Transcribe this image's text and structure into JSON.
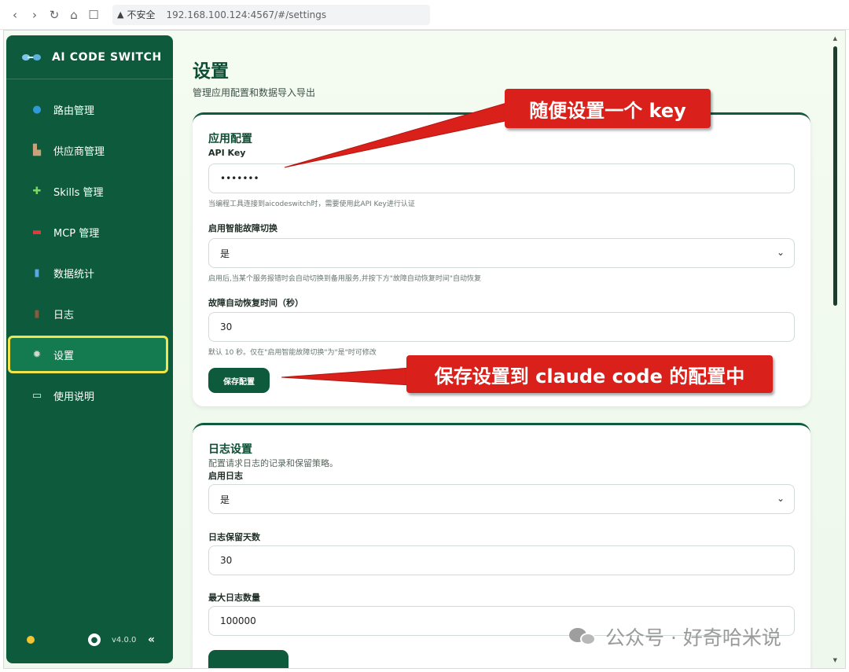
{
  "browser": {
    "back": "‹",
    "forward": "›",
    "reload": "↻",
    "home": "⌂",
    "bookmark": "☐",
    "warn_icon": "▲",
    "insecure_label": "不安全",
    "url": "192.168.100.124:4567/#/settings"
  },
  "sidebar": {
    "brand": "AI CODE SWITCH",
    "items": [
      {
        "label": "路由管理",
        "icon": "globe-icon",
        "glyph": "●",
        "color": "#2f9ad8"
      },
      {
        "label": "供应商管理",
        "icon": "factory-icon",
        "glyph": "▙",
        "color": "#c9a27a"
      },
      {
        "label": "Skills 管理",
        "icon": "puzzle-icon",
        "glyph": "✚",
        "color": "#7ed957"
      },
      {
        "label": "MCP 管理",
        "icon": "robot-icon",
        "glyph": "▬",
        "color": "#e0393e"
      },
      {
        "label": "数据统计",
        "icon": "chart-icon",
        "glyph": "▮",
        "color": "#5aa7e6"
      },
      {
        "label": "日志",
        "icon": "log-icon",
        "glyph": "▮",
        "color": "#8b5a3c"
      },
      {
        "label": "设置",
        "icon": "gear-icon",
        "glyph": "✹",
        "color": "#cfd8d3"
      },
      {
        "label": "使用说明",
        "icon": "book-icon",
        "glyph": "▭",
        "color": "#dfe9f5"
      }
    ],
    "active_index": 6,
    "github_glyph": "●",
    "version": "v4.0.0",
    "collapse": "«"
  },
  "page": {
    "title": "设置",
    "subtitle": "管理应用配置和数据导入导出"
  },
  "app_config": {
    "title": "应用配置",
    "api_key_label": "API Key",
    "api_key_value": "•••••••",
    "api_key_hint": "当编程工具连接到aicodeswitch时，需要使用此API Key进行认证",
    "failover_label": "启用智能故障切换",
    "failover_value": "是",
    "failover_hint": "启用后,当某个服务报错时会自动切换到备用服务,并按下方\"故障自动恢复时间\"自动恢复",
    "recovery_label": "故障自动恢复时间（秒）",
    "recovery_value": "30",
    "recovery_hint": "默认 10 秒。仅在\"启用智能故障切换\"为\"是\"时可修改",
    "save_button": "保存配置"
  },
  "log_config": {
    "title": "日志设置",
    "desc": "配置请求日志的记录和保留策略。",
    "enable_label": "启用日志",
    "enable_value": "是",
    "retention_label": "日志保留天数",
    "retention_value": "30",
    "max_label": "最大日志数量",
    "max_value": "100000"
  },
  "annotations": {
    "callout_key": "随便设置一个 key",
    "callout_save": "保存设置到  claude code 的配置中"
  },
  "watermark": "公众号 · 好奇哈米说",
  "colors": {
    "sidebar_bg": "#0e5a3c",
    "accent": "#0e5a3c",
    "highlight_outline": "#f1e54a",
    "callout_red": "#d9201a"
  }
}
